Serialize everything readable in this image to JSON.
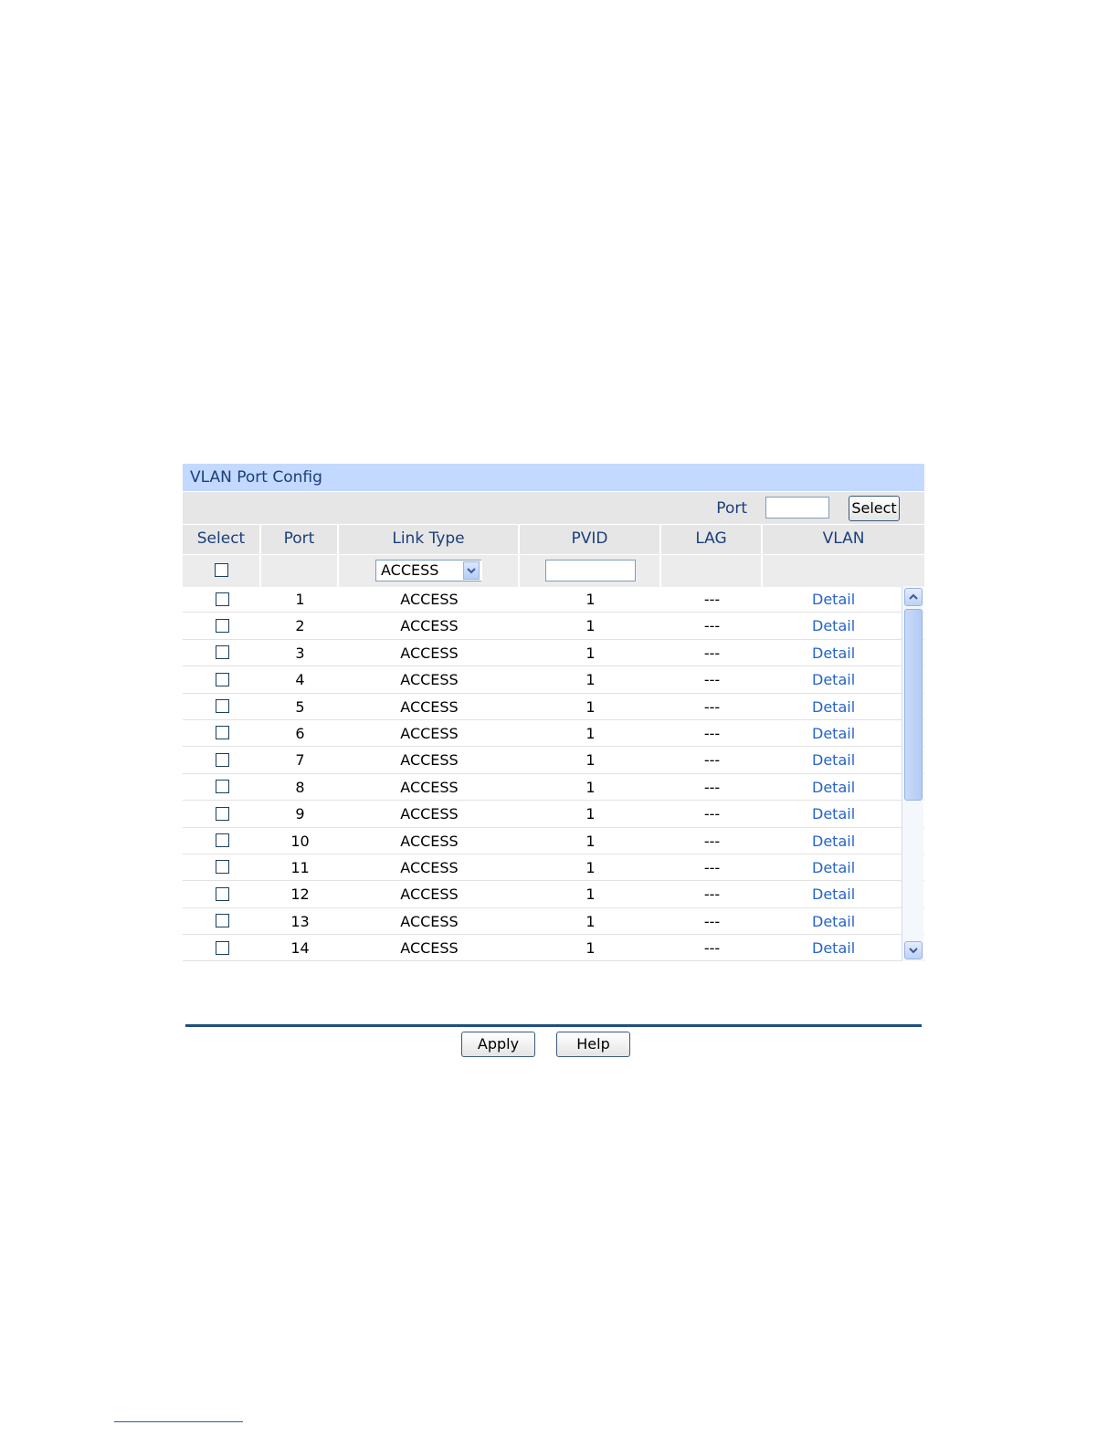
{
  "panel": {
    "title": "VLAN Port Config",
    "port_filter": {
      "label": "Port",
      "value": "",
      "select_label": "Select"
    },
    "columns": [
      "Select",
      "Port",
      "Link Type",
      "PVID",
      "LAG",
      "VLAN"
    ],
    "filter_row": {
      "link_type": "ACCESS",
      "pvid": ""
    },
    "rows": [
      {
        "port": "1",
        "link_type": "ACCESS",
        "pvid": "1",
        "lag": "---",
        "vlan": "Detail"
      },
      {
        "port": "2",
        "link_type": "ACCESS",
        "pvid": "1",
        "lag": "---",
        "vlan": "Detail"
      },
      {
        "port": "3",
        "link_type": "ACCESS",
        "pvid": "1",
        "lag": "---",
        "vlan": "Detail"
      },
      {
        "port": "4",
        "link_type": "ACCESS",
        "pvid": "1",
        "lag": "---",
        "vlan": "Detail"
      },
      {
        "port": "5",
        "link_type": "ACCESS",
        "pvid": "1",
        "lag": "---",
        "vlan": "Detail"
      },
      {
        "port": "6",
        "link_type": "ACCESS",
        "pvid": "1",
        "lag": "---",
        "vlan": "Detail"
      },
      {
        "port": "7",
        "link_type": "ACCESS",
        "pvid": "1",
        "lag": "---",
        "vlan": "Detail"
      },
      {
        "port": "8",
        "link_type": "ACCESS",
        "pvid": "1",
        "lag": "---",
        "vlan": "Detail"
      },
      {
        "port": "9",
        "link_type": "ACCESS",
        "pvid": "1",
        "lag": "---",
        "vlan": "Detail"
      },
      {
        "port": "10",
        "link_type": "ACCESS",
        "pvid": "1",
        "lag": "---",
        "vlan": "Detail"
      },
      {
        "port": "11",
        "link_type": "ACCESS",
        "pvid": "1",
        "lag": "---",
        "vlan": "Detail"
      },
      {
        "port": "12",
        "link_type": "ACCESS",
        "pvid": "1",
        "lag": "---",
        "vlan": "Detail"
      },
      {
        "port": "13",
        "link_type": "ACCESS",
        "pvid": "1",
        "lag": "---",
        "vlan": "Detail"
      },
      {
        "port": "14",
        "link_type": "ACCESS",
        "pvid": "1",
        "lag": "---",
        "vlan": "Detail"
      }
    ],
    "buttons": {
      "apply": "Apply",
      "help": "Help"
    }
  },
  "colors": {
    "title_bar": "#c3d9ff",
    "link": "#2563c9",
    "divider": "#1f4f7f"
  }
}
